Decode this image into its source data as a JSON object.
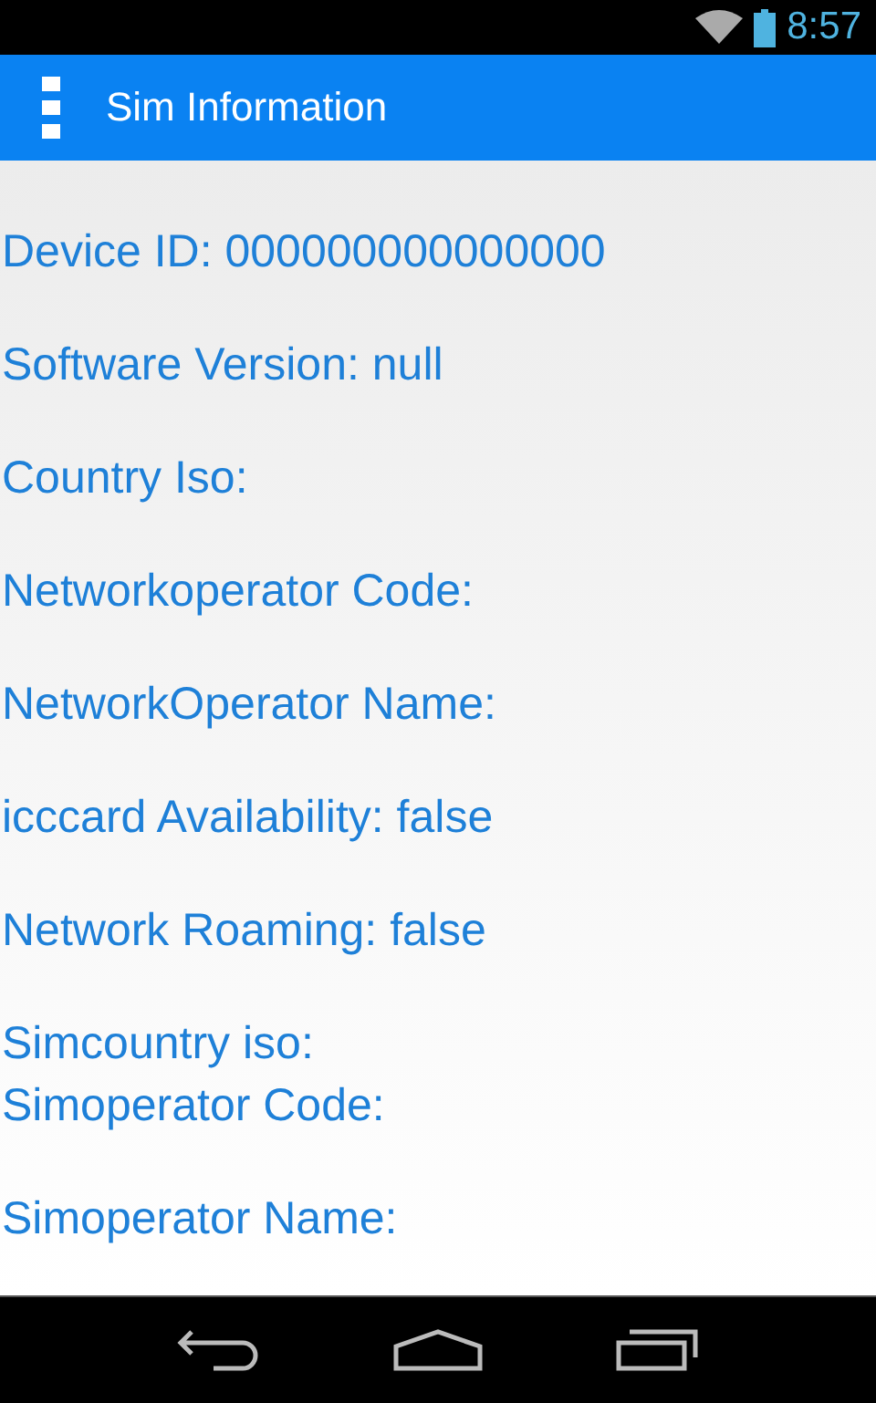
{
  "status_bar": {
    "time": "8:57"
  },
  "app_bar": {
    "title": "Sim Information"
  },
  "groups": [
    {
      "lines": [
        "Device ID: 000000000000000"
      ]
    },
    {
      "lines": [
        "Software Version: null"
      ]
    },
    {
      "lines": [
        "Country Iso:"
      ]
    },
    {
      "lines": [
        "Networkoperator Code:"
      ]
    },
    {
      "lines": [
        "NetworkOperator Name:"
      ]
    },
    {
      "lines": [
        "icccard Availability: false"
      ]
    },
    {
      "lines": [
        "Network Roaming: false"
      ]
    },
    {
      "lines": [
        "Simcountry iso:",
        "Simoperator Code:"
      ]
    },
    {
      "lines": [
        "Simoperator Name:"
      ]
    }
  ]
}
